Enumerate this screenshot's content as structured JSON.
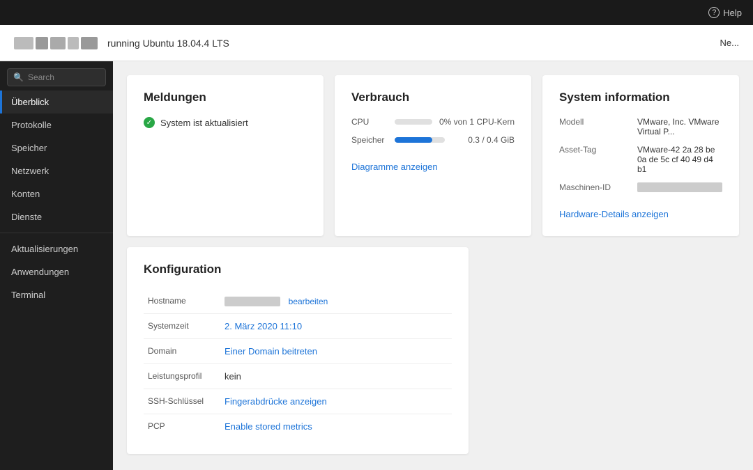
{
  "topbar": {
    "help_label": "Help"
  },
  "vm_header": {
    "status_text": "running Ubuntu 18.04.4 LTS",
    "action_label": "Ne..."
  },
  "sidebar": {
    "search_placeholder": "Search",
    "items": [
      {
        "id": "uberblick",
        "label": "Überblick",
        "active": true
      },
      {
        "id": "protokolle",
        "label": "Protokolle",
        "active": false
      },
      {
        "id": "speicher",
        "label": "Speicher",
        "active": false
      },
      {
        "id": "netzwerk",
        "label": "Netzwerk",
        "active": false
      },
      {
        "id": "konten",
        "label": "Konten",
        "active": false
      },
      {
        "id": "dienste",
        "label": "Dienste",
        "active": false
      },
      {
        "id": "aktualisierungen",
        "label": "Aktualisierungen",
        "active": false
      },
      {
        "id": "anwendungen",
        "label": "Anwendungen",
        "active": false
      },
      {
        "id": "terminal",
        "label": "Terminal",
        "active": false
      }
    ]
  },
  "meldungen": {
    "title": "Meldungen",
    "status_text": "System ist aktualisiert"
  },
  "verbrauch": {
    "title": "Verbrauch",
    "cpu_label": "CPU",
    "cpu_value": "0% von 1 CPU-Kern",
    "cpu_percent": 0,
    "speicher_label": "Speicher",
    "speicher_value": "0.3 / 0.4 GiB",
    "speicher_percent": 75,
    "link_label": "Diagramme anzeigen"
  },
  "system_info": {
    "title": "System information",
    "modell_label": "Modell",
    "modell_value": "VMware, Inc. VMware Virtual P...",
    "asset_label": "Asset-Tag",
    "asset_value": "VMware-42 2a 28 be 0a de 5c cf 40 49 d4 b1",
    "maschinen_label": "Maschinen-ID",
    "maschinen_value": "████████████████",
    "link_label": "Hardware-Details anzeigen"
  },
  "konfiguration": {
    "title": "Konfiguration",
    "hostname_label": "Hostname",
    "hostname_value": "██████████████",
    "hostname_edit": "bearbeiten",
    "systemzeit_label": "Systemzeit",
    "systemzeit_value": "2. März 2020 11:10",
    "domain_label": "Domain",
    "domain_value": "Einer Domain beitreten",
    "leistungsprofil_label": "Leistungsprofil",
    "leistungsprofil_value": "kein",
    "ssh_label": "SSH-Schlüssel",
    "ssh_value": "Fingerabdrücke anzeigen",
    "pcp_label": "PCP",
    "pcp_value": "Enable stored metrics"
  }
}
